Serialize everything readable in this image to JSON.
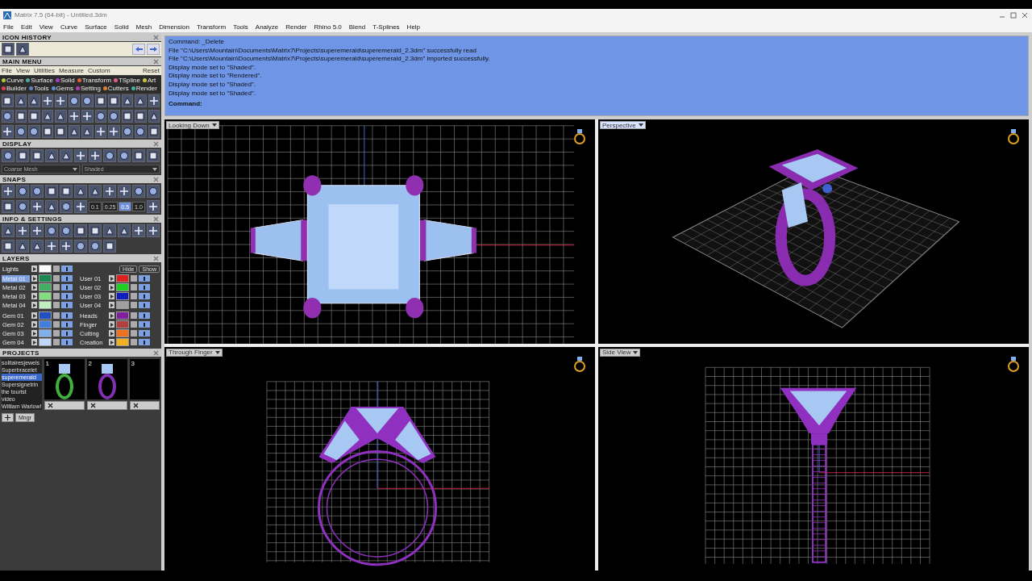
{
  "window": {
    "title": "Matrix 7.5 (64-bit) - Untitled.3dm"
  },
  "menu_bar": [
    "File",
    "Edit",
    "View",
    "Curve",
    "Surface",
    "Solid",
    "Mesh",
    "Dimension",
    "Transform",
    "Tools",
    "Analyze",
    "Render",
    "Rhino 5.0",
    "Blend",
    "T-Splines",
    "Help"
  ],
  "icon_history": {
    "title": "ICON HISTORY"
  },
  "main_menu": {
    "title": "MAIN MENU",
    "menu": [
      "File",
      "View",
      "Utilities",
      "Measure",
      "Custom"
    ],
    "reset": "Reset",
    "categories": [
      {
        "label": "Curve",
        "color": "#b5c740"
      },
      {
        "label": "Surface",
        "color": "#4fa8a0"
      },
      {
        "label": "Solid",
        "color": "#a040c0"
      },
      {
        "label": "Transform",
        "color": "#e06040"
      },
      {
        "label": "TSpline",
        "color": "#e06080"
      },
      {
        "label": "Art",
        "color": "#c8c840"
      },
      {
        "label": "Builder",
        "color": "#e04050"
      },
      {
        "label": "Tools",
        "color": "#6080c0"
      },
      {
        "label": "Gems",
        "color": "#6090d0"
      },
      {
        "label": "Setting",
        "color": "#b040b0"
      },
      {
        "label": "Cutters",
        "color": "#e08030"
      },
      {
        "label": "Render",
        "color": "#40b0a0"
      }
    ]
  },
  "display": {
    "title": "DISPLAY",
    "mesh": "Coarse Mesh",
    "mode": "Shaded"
  },
  "snaps": {
    "title": "SNAPS",
    "steps": [
      {
        "label": "0.1",
        "selected": false
      },
      {
        "label": "0.25",
        "selected": false
      },
      {
        "label": "0.5",
        "selected": true
      },
      {
        "label": "1.0",
        "selected": false
      }
    ]
  },
  "info_settings": {
    "title": "INFO & SETTINGS"
  },
  "layers": {
    "title": "LAYERS",
    "lights": {
      "name": "Lights",
      "color": "#ffffff",
      "visible": true
    },
    "hide": "Hide",
    "show": "Show",
    "columns": [
      [
        [
          {
            "name": "Metal 01",
            "color": "#1a8a50",
            "selected": true,
            "visible": true
          },
          {
            "name": "Metal 02",
            "color": "#40b060",
            "selected": false,
            "visible": true
          },
          {
            "name": "Metal 03",
            "color": "#80e080",
            "selected": false,
            "visible": true
          },
          {
            "name": "Metal 04",
            "color": "#c0f0c0",
            "selected": false,
            "visible": true
          }
        ],
        [
          {
            "name": "Gem 01",
            "color": "#2050c0",
            "selected": false,
            "visible": true
          },
          {
            "name": "Gem 02",
            "color": "#4080e0",
            "selected": false,
            "visible": true
          },
          {
            "name": "Gem 03",
            "color": "#80b0f0",
            "selected": false,
            "visible": true
          },
          {
            "name": "Gem 04",
            "color": "#c0d8f8",
            "selected": false,
            "visible": true
          }
        ]
      ],
      [
        [
          {
            "name": "User 01",
            "color": "#e02020",
            "selected": false,
            "visible": true
          },
          {
            "name": "User 02",
            "color": "#20d020",
            "selected": false,
            "visible": true
          },
          {
            "name": "User 03",
            "color": "#1020c0",
            "selected": false,
            "visible": true
          },
          {
            "name": "User 04",
            "color": "#a0a0a0",
            "selected": false,
            "visible": true
          }
        ],
        [
          {
            "name": "Heads",
            "color": "#8020a0",
            "selected": false,
            "visible": true
          },
          {
            "name": "Finger",
            "color": "#b04040",
            "selected": false,
            "visible": true
          },
          {
            "name": "Cutting",
            "color": "#f07020",
            "selected": false,
            "visible": true
          },
          {
            "name": "Creation",
            "color": "#f0b020",
            "selected": false,
            "visible": true
          }
        ]
      ]
    ]
  },
  "projects": {
    "title": "PROJECTS",
    "items": [
      {
        "label": "solitairesjewels",
        "selected": false
      },
      {
        "label": "Superbracelet",
        "selected": false
      },
      {
        "label": "superemerald",
        "selected": true
      },
      {
        "label": "Supersignetrin",
        "selected": false
      },
      {
        "label": "the tourist",
        "selected": false
      },
      {
        "label": "video",
        "selected": false
      },
      {
        "label": "William Warlow!",
        "selected": false
      }
    ],
    "thumbnails": [
      {
        "number": "1",
        "kind": "ring",
        "color": "#40b040"
      },
      {
        "number": "2",
        "kind": "ring",
        "color": "#8030b0"
      },
      {
        "number": "3",
        "kind": "empty"
      }
    ],
    "manager": "Mngr"
  },
  "command": {
    "lines": [
      "Command: _Delete",
      "File \"C:\\Users\\Mountain\\Documents\\Matrix7\\Projects\\superemerald\\superemerald_2.3dm\" successfully read",
      "File \"C:\\Users\\Mountain\\Documents\\Matrix7\\Projects\\superemerald\\superemerald_2.3dm\" imported successfully.",
      "Display mode set to \"Shaded\".",
      "Display mode set to \"Rendered\".",
      "Display mode set to \"Shaded\".",
      "Display mode set to \"Shaded\"."
    ],
    "prompt": "Command:"
  },
  "viewports": [
    {
      "label": "Looking Down",
      "kind": "top",
      "selected": false
    },
    {
      "label": "Perspective",
      "kind": "perspective",
      "selected": true
    },
    {
      "label": "Through Finger",
      "kind": "front",
      "selected": false
    },
    {
      "label": "Side View",
      "kind": "side",
      "selected": false
    }
  ]
}
